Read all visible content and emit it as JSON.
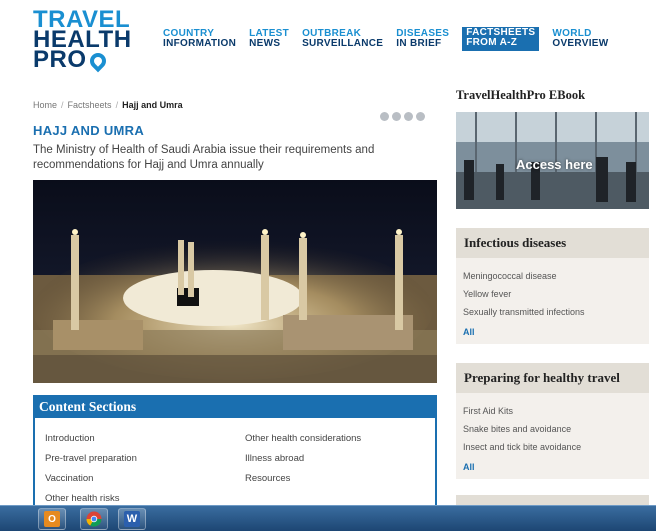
{
  "logo": {
    "line1": "TRAVEL",
    "line2": "HEALTH",
    "line3": "PRO"
  },
  "nav": [
    {
      "top": "COUNTRY",
      "bottom": "INFORMATION",
      "active": false
    },
    {
      "top": "LATEST",
      "bottom": "NEWS",
      "active": false
    },
    {
      "top": "OUTBREAK",
      "bottom": "SURVEILLANCE",
      "active": false
    },
    {
      "top": "DISEASES",
      "bottom": "IN BRIEF",
      "active": false
    },
    {
      "top": "FACTSHEETS",
      "bottom": "FROM A-Z",
      "active": true
    },
    {
      "top": "WORLD",
      "bottom": "OVERVIEW",
      "active": false
    }
  ],
  "breadcrumb": {
    "home": "Home",
    "sep": "/",
    "section": "Factsheets",
    "current": "Hajj and Umra"
  },
  "page": {
    "title": "HAJJ AND UMRA",
    "intro": "The Ministry of Health of Saudi Arabia issue their requirements and recommendations for Hajj and Umra annually"
  },
  "content_sections": {
    "heading": "Content Sections",
    "links": [
      "Introduction",
      "Other health considerations",
      "Pre-travel preparation",
      "Illness abroad",
      "Vaccination",
      "Resources",
      "Other health risks",
      ""
    ]
  },
  "right": {
    "ebook_title": "TravelHealthPro EBook",
    "ebook_cta": "Access here",
    "panels": [
      {
        "heading": "Infectious diseases",
        "items": [
          "Meningococcal disease",
          "Yellow fever",
          "Sexually transmitted infections"
        ],
        "all": "All"
      },
      {
        "heading": "Preparing for healthy travel",
        "items": [
          "First Aid Kits",
          "Snake bites and avoidance",
          "Insect and tick bite avoidance"
        ],
        "all": "All"
      }
    ]
  },
  "taskbar": {
    "outlook_letter": "O",
    "word_letter": "W"
  },
  "colors": {
    "brand_dark": "#0a3a6b",
    "brand_blue": "#1a6fb0",
    "brand_light": "#1a8fd1",
    "panel_bg": "#f3f0ec"
  }
}
